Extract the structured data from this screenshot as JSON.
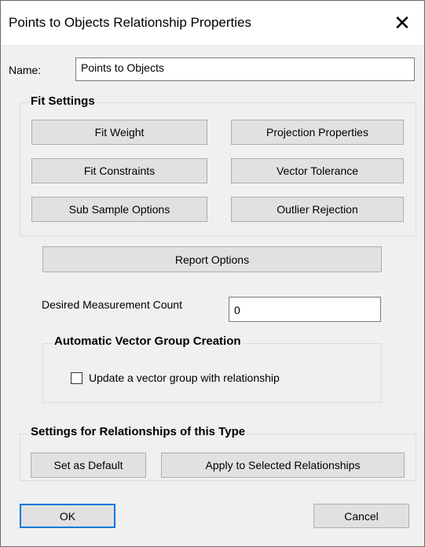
{
  "window": {
    "title": "Points to Objects Relationship Properties",
    "close_glyph": "✕"
  },
  "name_field": {
    "label": "Name:",
    "value": "Points to Objects"
  },
  "fit_settings": {
    "heading": "Fit Settings",
    "buttons": {
      "fit_weight": "Fit Weight",
      "projection_properties": "Projection Properties",
      "fit_constraints": "Fit Constraints",
      "vector_tolerance": "Vector Tolerance",
      "sub_sample_options": "Sub Sample Options",
      "outlier_rejection": "Outlier Rejection"
    }
  },
  "report_options_label": "Report Options",
  "measurement_count": {
    "label": "Desired Measurement Count",
    "value": "0"
  },
  "vector_group": {
    "heading": "Automatic Vector Group Creation",
    "checkbox_label": "Update a vector group with relationship",
    "checked": false
  },
  "relationship_settings": {
    "heading": "Settings for Relationships of this Type",
    "set_default": "Set as Default",
    "apply_selected": "Apply to Selected Relationships"
  },
  "footer": {
    "ok": "OK",
    "cancel": "Cancel"
  },
  "colors": {
    "dialog_bg": "#f0f0f0",
    "button_bg": "#e1e1e1",
    "default_button_border": "#0078d7"
  }
}
